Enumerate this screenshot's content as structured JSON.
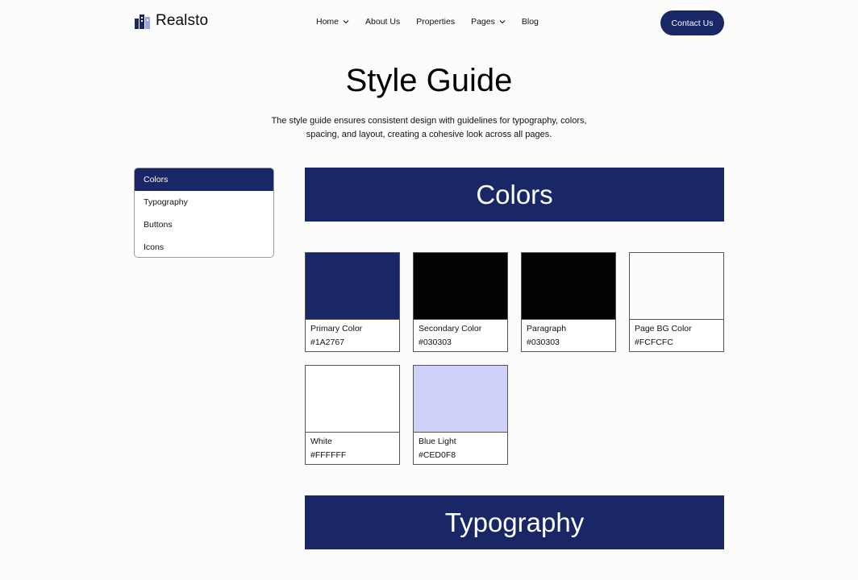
{
  "header": {
    "brand": "Realsto",
    "nav": [
      {
        "label": "Home",
        "has_dropdown": true
      },
      {
        "label": "About Us",
        "has_dropdown": false
      },
      {
        "label": "Properties",
        "has_dropdown": false
      },
      {
        "label": "Pages",
        "has_dropdown": true
      },
      {
        "label": "Blog",
        "has_dropdown": false
      }
    ],
    "cta": "Contact Us"
  },
  "hero": {
    "title": "Style Guide",
    "description_line1": "The style guide ensures consistent design with guidelines for typography, colors,",
    "description_line2": "spacing, and layout, creating a cohesive look across all pages."
  },
  "sidebar": {
    "items": [
      {
        "label": "Colors",
        "active": true
      },
      {
        "label": "Typography",
        "active": false
      },
      {
        "label": "Buttons",
        "active": false
      },
      {
        "label": "Icons",
        "active": false
      }
    ]
  },
  "sections": {
    "colors_title": "Colors",
    "typography_title": "Typography"
  },
  "swatches": [
    {
      "name": "Primary Color",
      "hex": "#1A2767",
      "color": "#1A2767"
    },
    {
      "name": "Secondary Color",
      "hex": "#030303",
      "color": "#030303"
    },
    {
      "name": "Paragraph",
      "hex": "#030303",
      "color": "#030303"
    },
    {
      "name": "Page BG Color",
      "hex": "#FCFCFC",
      "color": "#FCFCFC"
    },
    {
      "name": "White",
      "hex": "#FFFFFF",
      "color": "#FFFFFF"
    },
    {
      "name": "Blue Light",
      "hex": "#CED0F8",
      "color": "#CED0F8"
    }
  ],
  "colors": {
    "primary": "#1A2767",
    "page_bg": "#FCFCFC"
  }
}
